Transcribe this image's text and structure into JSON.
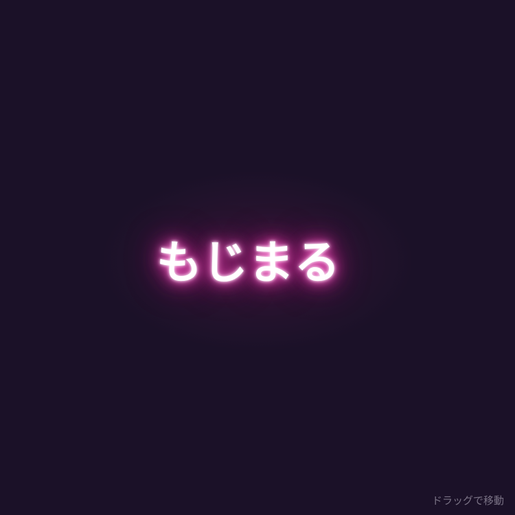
{
  "logo": {
    "text": "もじまる"
  },
  "hint": {
    "text": "ドラッグで移動"
  },
  "colors": {
    "background": "#1b1128",
    "text": "#ffffff",
    "glow": "#ff4fbf",
    "hint": "#c8c3d2"
  }
}
